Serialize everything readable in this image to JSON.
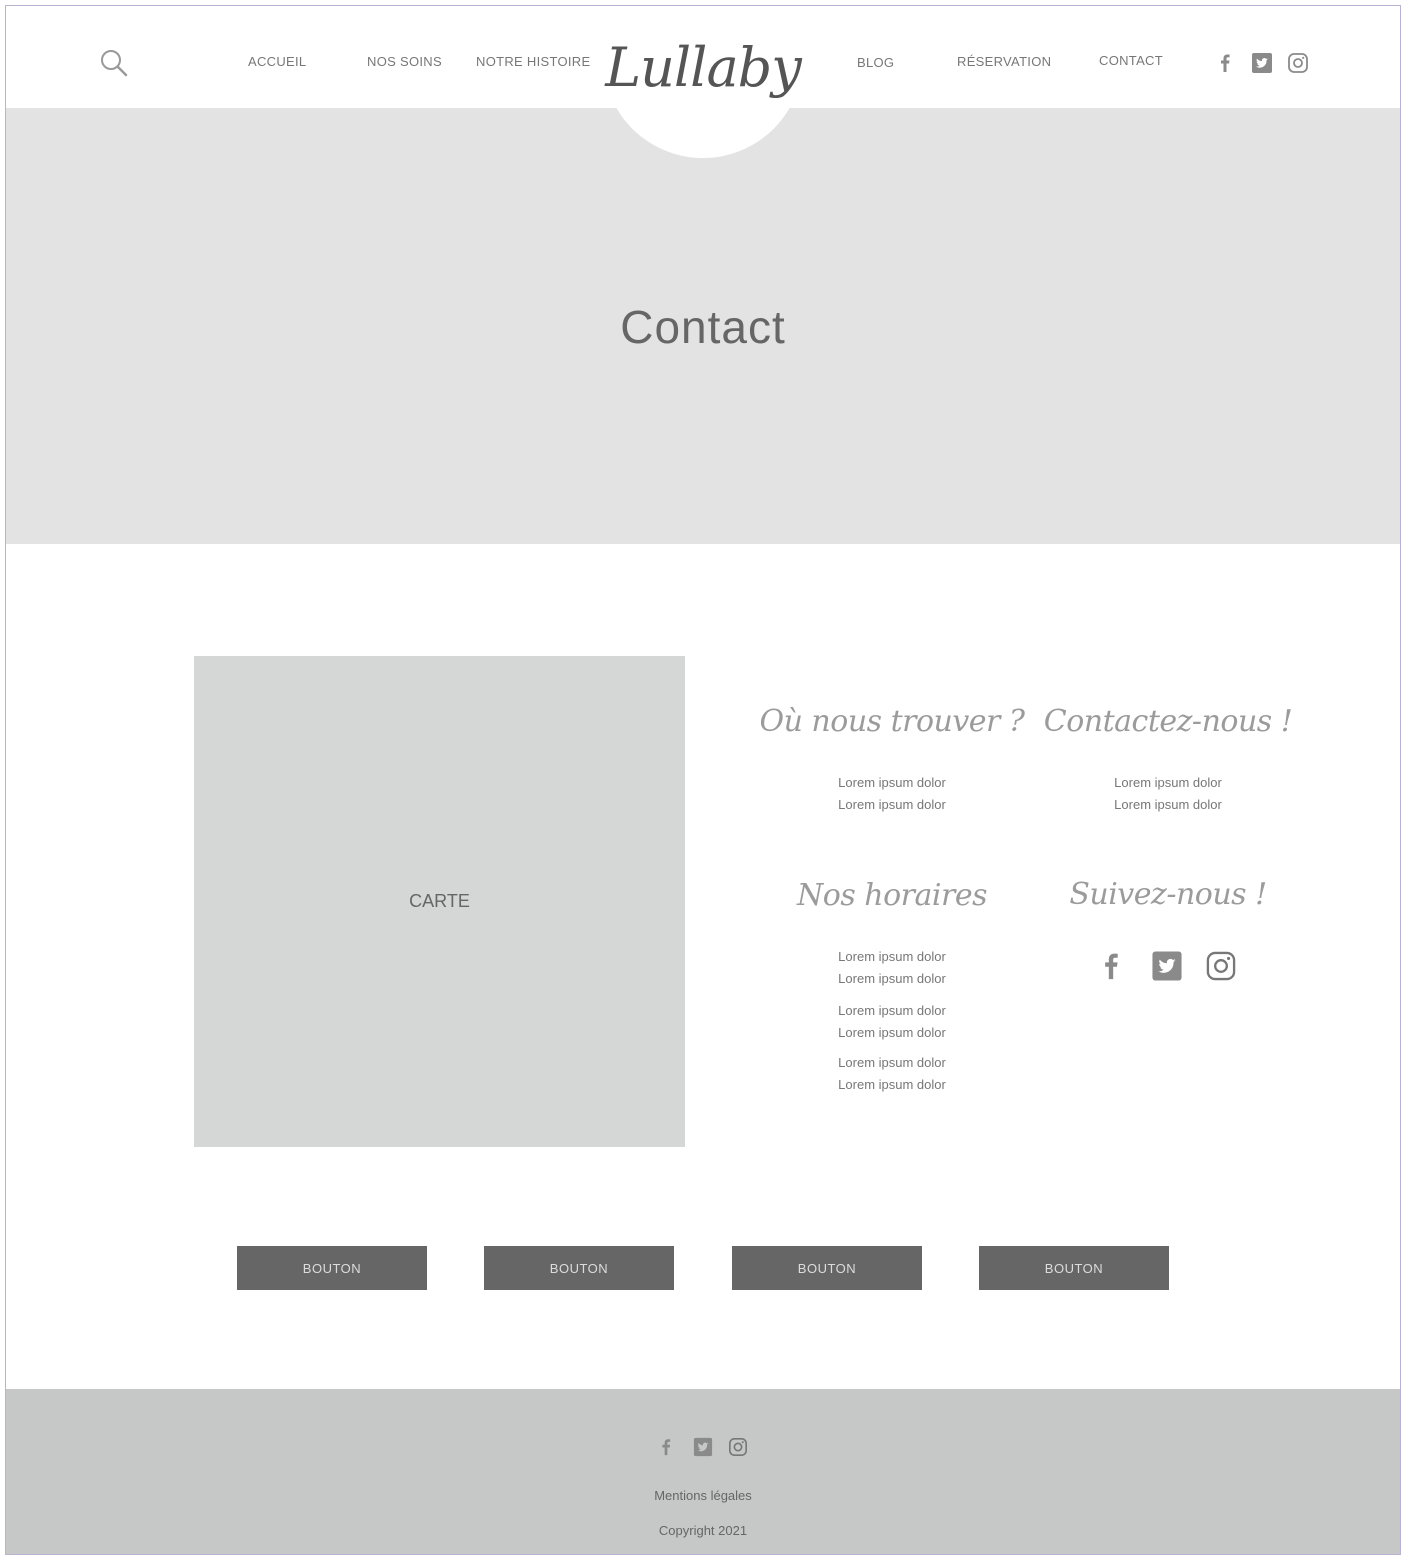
{
  "header": {
    "logo": "Lullaby",
    "nav_left": [
      "ACCUEIL",
      "NOS SOINS",
      "NOTRE HISTOIRE"
    ],
    "nav_right": [
      "BLOG",
      "RÉSERVATION",
      "CONTACT"
    ]
  },
  "hero": {
    "title": "Contact"
  },
  "map": {
    "label": "CARTE"
  },
  "blocks": {
    "where": {
      "title": "Où nous trouver ?",
      "lines": [
        "Lorem ipsum dolor",
        "Lorem ipsum dolor"
      ]
    },
    "contact": {
      "title": "Contactez-nous !",
      "lines": [
        "Lorem ipsum dolor",
        "Lorem ipsum dolor"
      ]
    },
    "hours": {
      "title": "Nos horaires",
      "lines": [
        "Lorem ipsum dolor",
        "Lorem ipsum dolor",
        "Lorem ipsum dolor",
        "Lorem ipsum dolor",
        "Lorem ipsum dolor",
        "Lorem ipsum dolor"
      ]
    },
    "follow": {
      "title": "Suivez-nous !"
    }
  },
  "buttons": [
    "BOUTON",
    "BOUTON",
    "BOUTON",
    "BOUTON"
  ],
  "footer": {
    "legal": "Mentions légales",
    "copyright": "Copyright 2021"
  },
  "icons": [
    "search-icon",
    "facebook-icon",
    "twitter-icon",
    "instagram-icon"
  ],
  "colors": {
    "hero_bg": "#e3e3e3",
    "map_bg": "#d5d6d6",
    "button_bg": "#666666",
    "footer_bg": "#c6c7c7"
  }
}
